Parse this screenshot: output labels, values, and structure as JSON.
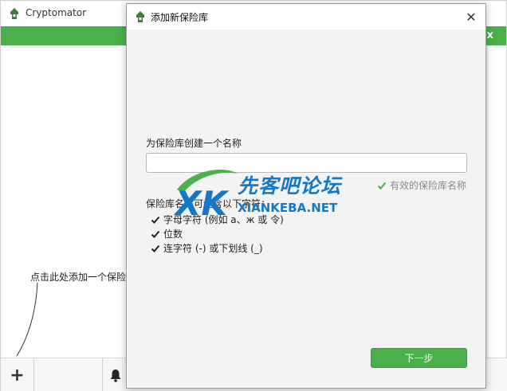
{
  "main_window": {
    "title": "Cryptomator",
    "close_glyph": "x",
    "hint": "点击此处添加一个保险",
    "add_glyph": "+"
  },
  "dialog": {
    "title": "添加新保险库",
    "close_glyph": "✕",
    "field_label": "为保险库创建一个名称",
    "input_value": "",
    "input_placeholder": "",
    "valid_message": "有效的保险库名称",
    "rules_title": "保险库名称可包含以下字符：",
    "rules": [
      "字母字符 (例如 a、ж 或 令)",
      "位数",
      "连字符 (-) 或下划线 (_)"
    ],
    "next_button": "下一步"
  },
  "watermark": {
    "logo_letters": "XK",
    "cn_text": "先客吧论坛",
    "en_text": "XIANKEBA.NET"
  },
  "colors": {
    "accent": "#49b04a",
    "watermark_blue": "#1577c8"
  },
  "icons": [
    "cryptomator-logo-icon",
    "close-icon",
    "plus-icon",
    "bell-icon",
    "check-icon"
  ]
}
